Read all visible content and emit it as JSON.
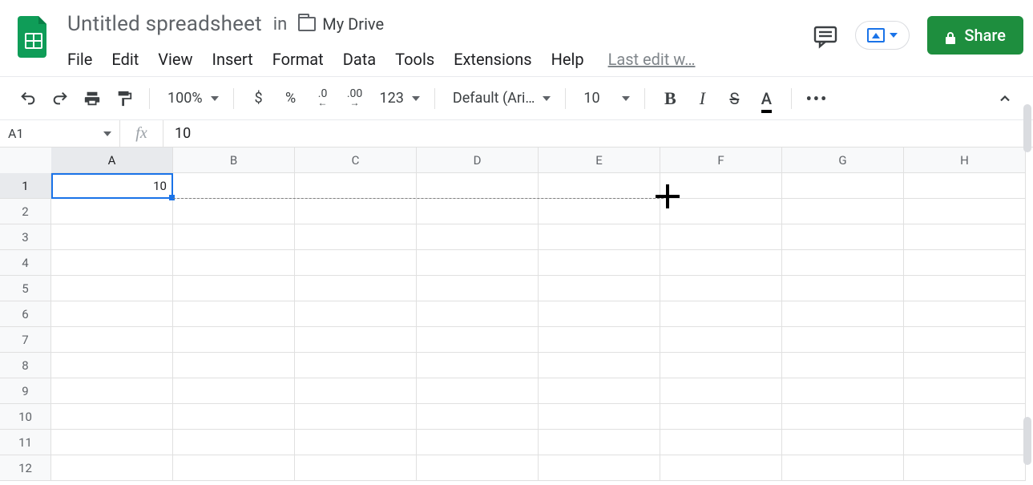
{
  "header": {
    "doc_title": "Untitled spreadsheet",
    "in_label": "in",
    "folder_name": "My Drive",
    "menus": [
      "File",
      "Edit",
      "View",
      "Insert",
      "Format",
      "Data",
      "Tools",
      "Extensions",
      "Help"
    ],
    "last_edit": "Last edit w…",
    "share_label": "Share"
  },
  "toolbar": {
    "zoom": "100%",
    "currency": "$",
    "percent": "%",
    "dec_decrease": ".0",
    "dec_increase": ".00",
    "more_formats": "123",
    "font": "Default (Ari…",
    "font_size": "10",
    "bold": "B",
    "italic": "I",
    "strike": "S",
    "text_color": "A",
    "more": "•••"
  },
  "fxbar": {
    "namebox": "A1",
    "fx_label": "fx",
    "formula": "10"
  },
  "grid": {
    "columns": [
      "A",
      "B",
      "C",
      "D",
      "E",
      "F",
      "G",
      "H"
    ],
    "rows": [
      "1",
      "2",
      "3",
      "4",
      "5",
      "6",
      "7",
      "8",
      "9",
      "10",
      "11",
      "12"
    ],
    "active_cell": "A1",
    "cells": {
      "A1": "10"
    }
  }
}
